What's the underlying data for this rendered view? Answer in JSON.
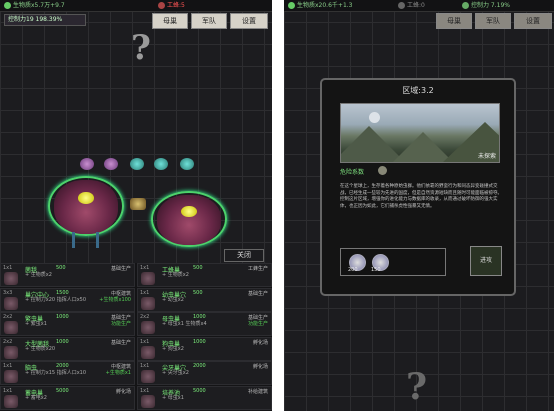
{
  "left": {
    "bio_label": "生物质x5.7万+9.7",
    "worker_label": "工蜂:5",
    "control_label": "控制力19 198.39%",
    "nav": [
      "母巢",
      "军队",
      "设置"
    ],
    "close_label": "关闭",
    "cards": [
      {
        "size": "1x1",
        "name": "菌毯",
        "cost": "500",
        "type": "基础生产",
        "desc": "+ 生物质x2",
        "extra": ""
      },
      {
        "size": "1x1",
        "name": "工蜂巢",
        "cost": "500",
        "type": "工蜂生产",
        "desc": "+ 生物质x2",
        "extra": ""
      },
      {
        "size": "3x3",
        "name": "巢穴中心",
        "cost": "1500",
        "type": "中枢建筑",
        "desc": "+ 控制力x20  指挥人口x50",
        "extra": "+生物质x100"
      },
      {
        "size": "1x1",
        "name": "幼虫巢穴",
        "cost": "500",
        "type": "基础生产",
        "desc": "+ 幼虫x2",
        "extra": ""
      },
      {
        "size": "2x2",
        "name": "繁虫巢",
        "cost": "1000",
        "type": "基础生产",
        "desc": "+ 繁虫x1",
        "extra": "功能生产"
      },
      {
        "size": "2x2",
        "name": "母虫巢",
        "cost": "1000",
        "type": "基础生产",
        "desc": "+ 母虫x1  生物质x4",
        "extra": "功能生产"
      },
      {
        "size": "2x2",
        "name": "大型菌毯",
        "cost": "1000",
        "type": "基础生产",
        "desc": "+ 生物质x20",
        "extra": ""
      },
      {
        "size": "1x1",
        "name": "狗虫巢",
        "cost": "1000",
        "type": "孵化场",
        "desc": "+ 狗虫x2",
        "extra": ""
      },
      {
        "size": "1x1",
        "name": "脑虫",
        "cost": "2000",
        "type": "中枢建筑",
        "desc": "+ 控制力x15  指挥人口x10",
        "extra": "+生物质x1"
      },
      {
        "size": "1x1",
        "name": "尖牙巢穴",
        "cost": "2000",
        "type": "孵化场",
        "desc": "+ 尖牙虫x2",
        "extra": ""
      },
      {
        "size": "1x1",
        "name": "蓄电巢",
        "cost": "5000",
        "type": "孵化场",
        "desc": "+ 蓄电x2",
        "extra": ""
      },
      {
        "size": "1x1",
        "name": "培养池",
        "cost": "5000",
        "type": "补给建筑",
        "desc": "+ 母虫x1",
        "extra": ""
      }
    ]
  },
  "right": {
    "bio_label": "生物质x20.6千+1.3",
    "worker_label": "工蜂:0",
    "control_label": "控制力 7.19%",
    "nav": [
      "母巢",
      "军队",
      "设置"
    ],
    "modal": {
      "title": "区域:3.2",
      "unexplored": "未探索",
      "danger_label": "危险系数",
      "description": "在这个星球上，生存着各种原始虫群。他们依靠的野蛮行为和同态异变碰撞式交战，已经生成一些较为先进的国度，但是自然资源短缺而且随时可能面临被掠夺。控制这片区域，增强你的进化能力与数据库的收录，从而通过破坏防御的强大实体，也正因为如此，它们捕杀虎性强暴又无情。",
      "enemies": [
        "200",
        "150"
      ],
      "attack_label": "进攻"
    }
  },
  "colors": {
    "accent_green": "#7cf07c",
    "ring_green": "#4cd36c",
    "red": "#ff5555"
  }
}
